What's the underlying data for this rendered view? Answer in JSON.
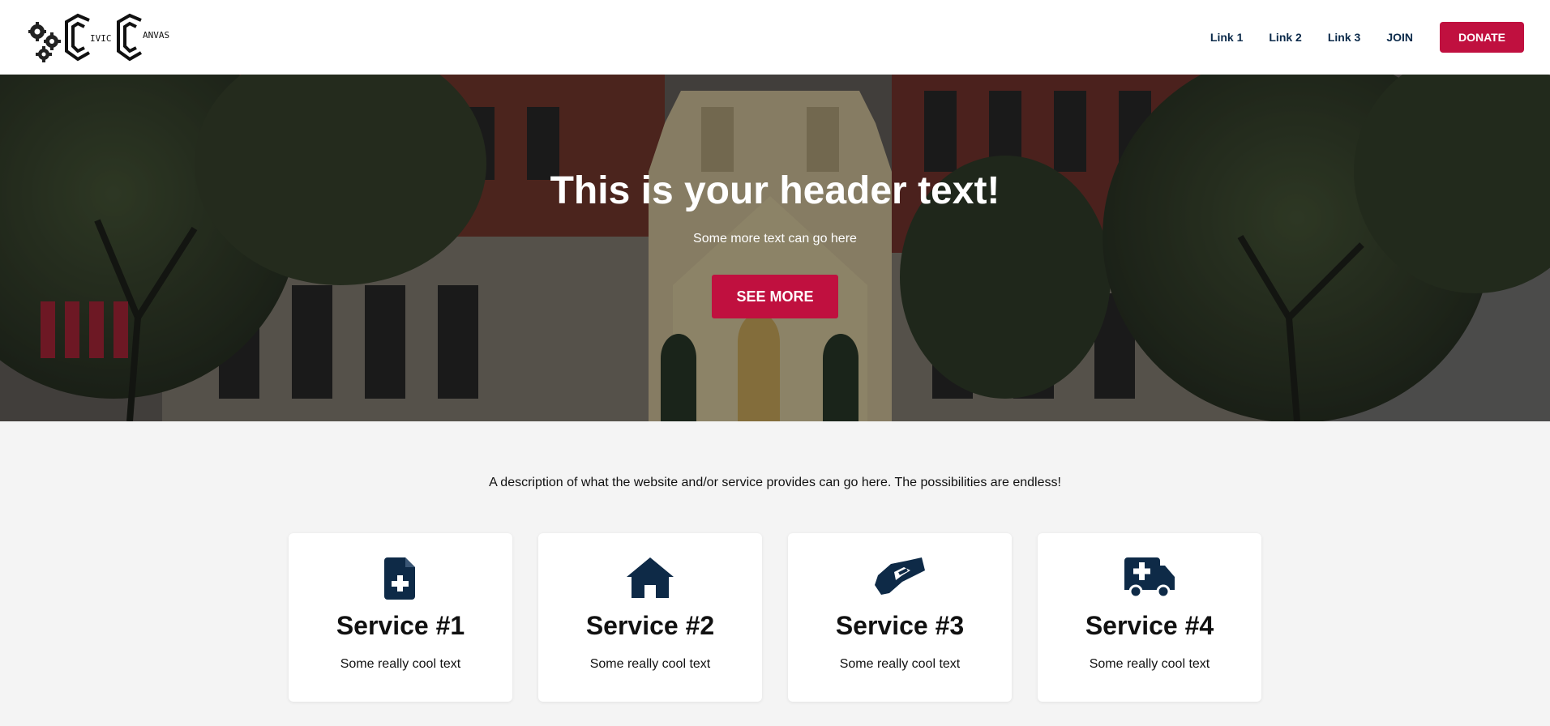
{
  "brand": {
    "logo_text_1": "IVIC",
    "logo_text_2": "ANVAS"
  },
  "nav": {
    "links": [
      "Link 1",
      "Link 2",
      "Link 3",
      "JOIN"
    ],
    "donate_label": "DONATE"
  },
  "hero": {
    "title": "This is your header text!",
    "subtitle": "Some more text can go here",
    "cta_label": "SEE MORE"
  },
  "description": "A description of what the website and/or service provides can go here. The possibilities are endless!",
  "services": [
    {
      "icon": "file-medical-icon",
      "title": "Service #1",
      "text": "Some really cool text"
    },
    {
      "icon": "house-icon",
      "title": "Service #2",
      "text": "Some really cool text"
    },
    {
      "icon": "handshake-icon",
      "title": "Service #3",
      "text": "Some really cool text"
    },
    {
      "icon": "ambulance-icon",
      "title": "Service #4",
      "text": "Some really cool text"
    }
  ],
  "colors": {
    "accent": "#c0103f",
    "navy": "#0b2a4a",
    "icon": "#0e2a47"
  }
}
